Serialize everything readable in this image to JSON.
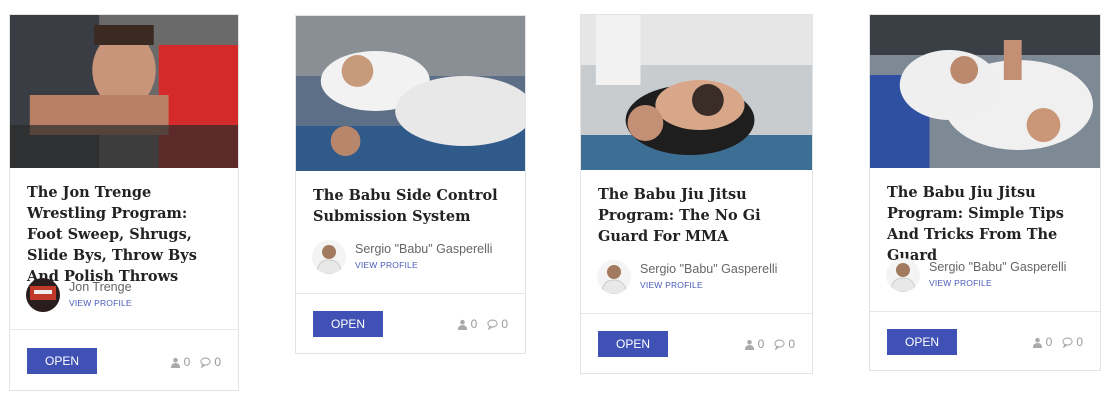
{
  "cards": [
    {
      "title": "The Jon Trenge Wrestling Program: Foot Sweep, Shrugs, Slide Bys, Throw Bys And Polish Throws",
      "author": "Jon Trenge",
      "view_profile": "VIEW PROFILE",
      "open_label": "OPEN",
      "students": "0",
      "comments": "0"
    },
    {
      "title": "The Babu Side Control Submission System",
      "author": "Sergio \"Babu\" Gasperelli",
      "view_profile": "VIEW PROFILE",
      "open_label": "OPEN",
      "students": "0",
      "comments": "0"
    },
    {
      "title": "The Babu Jiu Jitsu Program: The No Gi Guard For MMA",
      "author": "Sergio \"Babu\" Gasperelli",
      "view_profile": "VIEW PROFILE",
      "open_label": "OPEN",
      "students": "0",
      "comments": "0"
    },
    {
      "title": "The Babu Jiu Jitsu Program: Simple Tips And Tricks From The Guard",
      "author": "Sergio \"Babu\" Gasperelli",
      "view_profile": "VIEW PROFILE",
      "open_label": "OPEN",
      "students": "0",
      "comments": "0"
    }
  ],
  "colors": {
    "button": "#3f51b5",
    "link": "#4a5bb8",
    "border": "#e3e3e3"
  },
  "icons": {
    "students": "user-icon",
    "comments": "comment-icon"
  }
}
